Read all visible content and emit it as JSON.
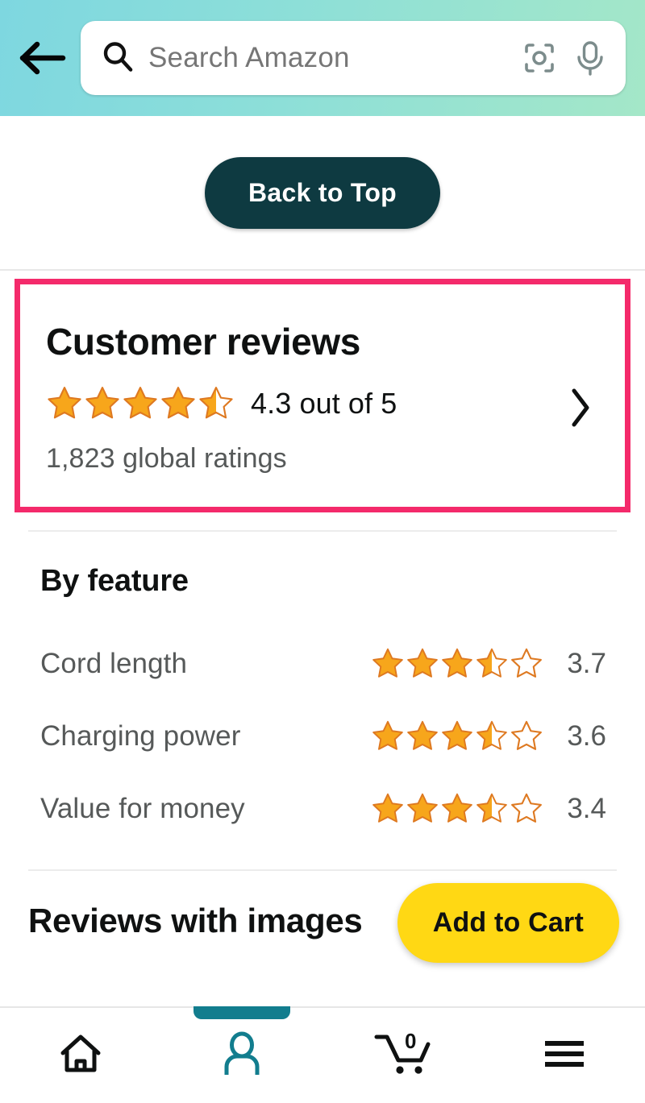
{
  "header": {
    "back_icon": "back-arrow-icon",
    "search": {
      "placeholder": "Search Amazon",
      "value": "",
      "search_icon": "search-icon",
      "camera_icon": "camera-scan-icon",
      "mic_icon": "microphone-icon"
    },
    "gradient_from": "#7ed7e0",
    "gradient_to": "#a4e7c8"
  },
  "back_to_top": {
    "label": "Back to Top",
    "bg_color": "#0e3a41",
    "text_color": "#ffffff"
  },
  "customer_reviews": {
    "title": "Customer reviews",
    "rating_value": 4.3,
    "rating_text": "4.3 out of 5",
    "stars_filled": 4.5,
    "global_ratings": "1,823 global ratings",
    "chevron_icon": "chevron-right-icon",
    "highlight_color": "#f42a6b"
  },
  "by_feature": {
    "title": "By feature",
    "features": [
      {
        "label": "Cord length",
        "score": "3.7",
        "stars": 3.5
      },
      {
        "label": "Charging power",
        "score": "3.6",
        "stars": 3.5
      },
      {
        "label": "Value for money",
        "score": "3.4",
        "stars": 3.5
      }
    ]
  },
  "reviews_with_images": {
    "title": "Reviews with images"
  },
  "add_to_cart": {
    "label": "Add to Cart",
    "bg_color": "#ffd814"
  },
  "bottom_nav": {
    "active_index": 1,
    "accent_color": "#127d8e",
    "items": [
      {
        "name": "home",
        "icon": "home-icon",
        "label": "",
        "badge": ""
      },
      {
        "name": "account",
        "icon": "person-icon",
        "label": "",
        "badge": ""
      },
      {
        "name": "cart",
        "icon": "cart-icon",
        "label": "",
        "badge": "0"
      },
      {
        "name": "menu",
        "icon": "hamburger-icon",
        "label": "",
        "badge": ""
      }
    ]
  },
  "star_colors": {
    "fill": "#f7a61b",
    "stroke": "#de7921"
  }
}
